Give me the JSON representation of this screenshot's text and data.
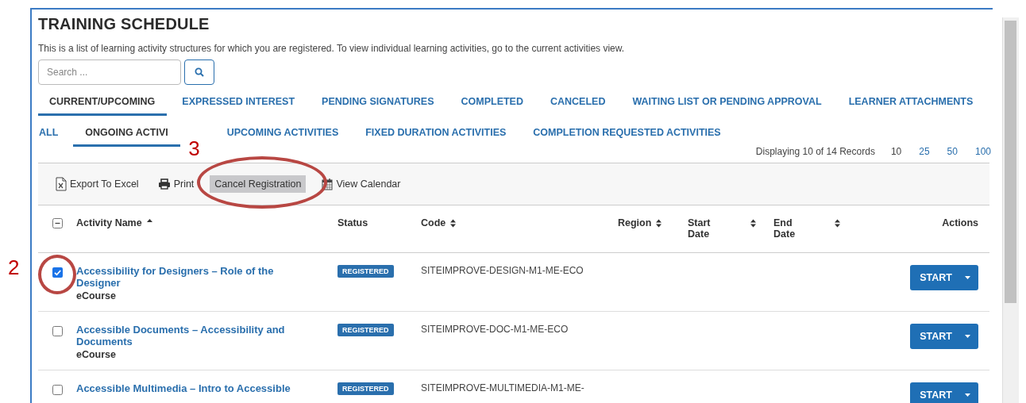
{
  "title": "TRAINING SCHEDULE",
  "description": "This is a list of learning activity structures for which you are registered. To view individual learning activities, go to the current activities view.",
  "search": {
    "placeholder": "Search ..."
  },
  "tabs": [
    {
      "label": "CURRENT/UPCOMING",
      "selected": true
    },
    {
      "label": "EXPRESSED INTEREST",
      "selected": false
    },
    {
      "label": "PENDING SIGNATURES",
      "selected": false
    },
    {
      "label": "COMPLETED",
      "selected": false
    },
    {
      "label": "CANCELED",
      "selected": false
    },
    {
      "label": "WAITING LIST OR PENDING APPROVAL",
      "selected": false
    },
    {
      "label": "LEARNER ATTACHMENTS",
      "selected": false
    }
  ],
  "subtabs": [
    {
      "label": "ALL",
      "selected": false
    },
    {
      "label": "ONGOING ACTIVI",
      "selected": true
    },
    {
      "label": "UPCOMING ACTIVITIES",
      "selected": false
    },
    {
      "label": "FIXED DURATION ACTIVITIES",
      "selected": false
    },
    {
      "label": "COMPLETION REQUESTED ACTIVITIES",
      "selected": false
    }
  ],
  "paging": {
    "summary": "Displaying 10 of 14 Records",
    "sizes": [
      {
        "label": "10",
        "selected": true
      },
      {
        "label": "25",
        "selected": false
      },
      {
        "label": "50",
        "selected": false
      },
      {
        "label": "100",
        "selected": false
      }
    ]
  },
  "toolbar": [
    {
      "kind": "excel",
      "label": "Export To Excel",
      "highlighted": false
    },
    {
      "kind": "print",
      "label": "Print",
      "highlighted": false
    },
    {
      "kind": "none",
      "label": "Cancel Registration",
      "highlighted": true,
      "annotation": "3"
    },
    {
      "kind": "calendar",
      "label": "View Calendar",
      "highlighted": false
    }
  ],
  "table": {
    "select_all": {
      "indeterminate": true
    },
    "columns": [
      {
        "label": "Activity Name",
        "sortable": true,
        "sorted": true
      },
      {
        "label": "Status",
        "sortable": false
      },
      {
        "label": "Code",
        "sortable": true,
        "sorted": false
      },
      {
        "label": "Region",
        "sortable": true,
        "sorted": false
      },
      {
        "label": "Start Date",
        "sortable": true,
        "sorted": false
      },
      {
        "label": "End Date",
        "sortable": true,
        "sorted": false
      },
      {
        "label": "Actions",
        "sortable": false
      }
    ],
    "rows": [
      {
        "checked": true,
        "annotation": "2",
        "name": "Accessibility for Designers – Role of the Designer",
        "type": "eCourse",
        "status": "REGISTERED",
        "code": "SITEIMPROVE-DESIGN-M1-ME-ECO",
        "action": "START"
      },
      {
        "checked": false,
        "name": "Accessible Documents – Accessibility and Documents",
        "type": "eCourse",
        "status": "REGISTERED",
        "code": "SITEIMPROVE-DOC-M1-ME-ECO",
        "action": "START"
      },
      {
        "checked": false,
        "name": "Accessible Multimedia – Intro to Accessible",
        "status": "REGISTERED",
        "code": "SITEIMPROVE-MULTIMEDIA-M1-ME-",
        "action": "START"
      }
    ]
  }
}
